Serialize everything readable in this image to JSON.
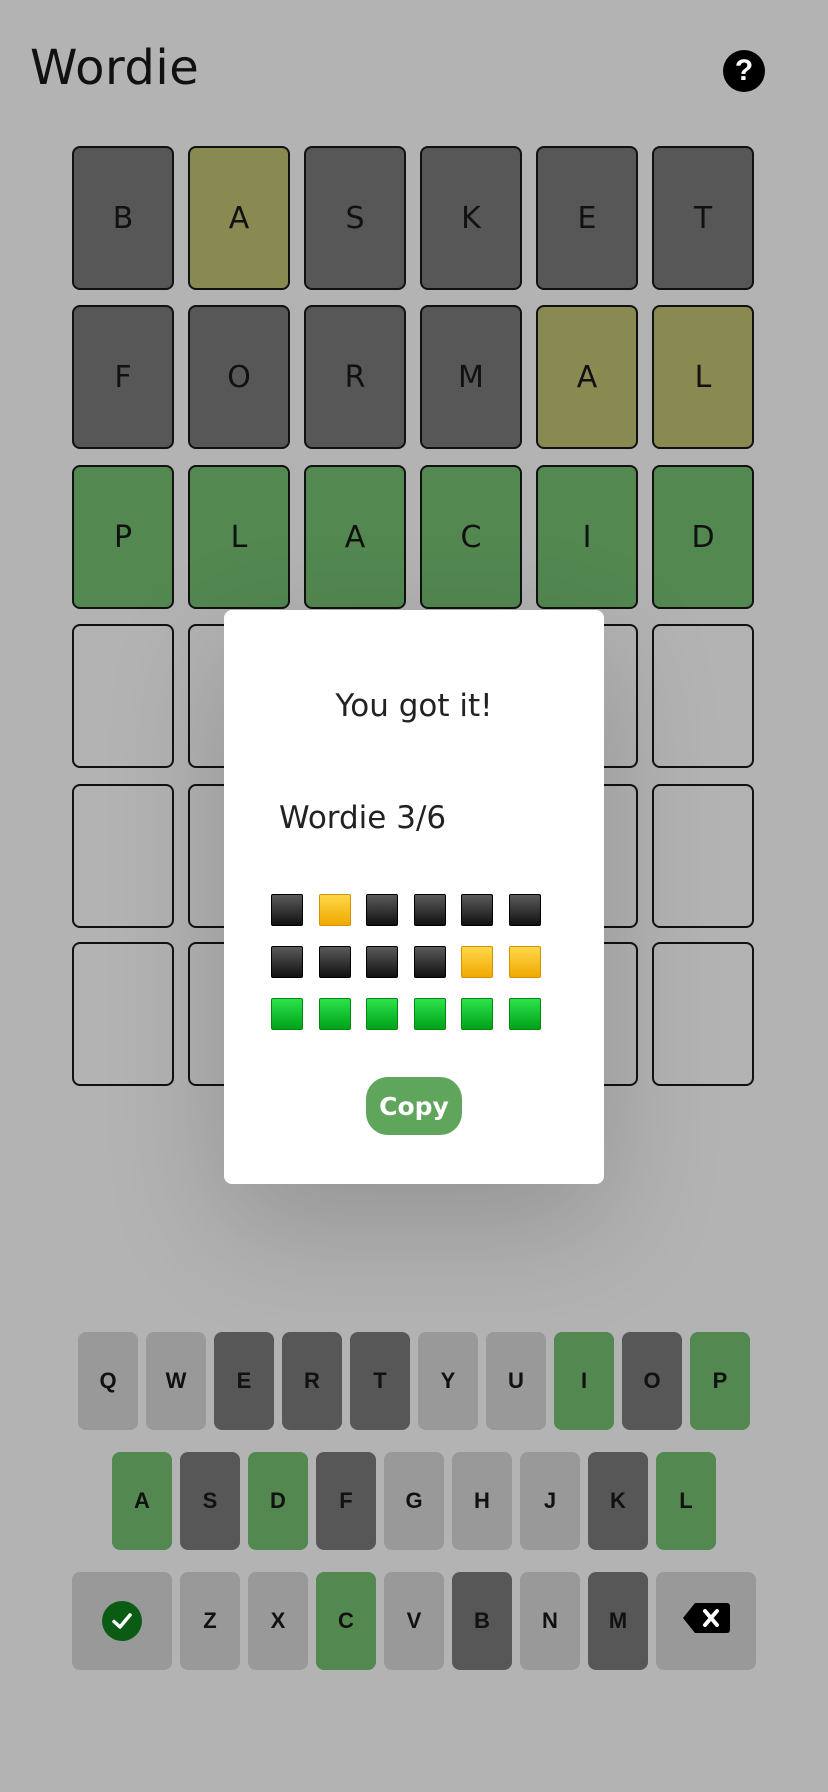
{
  "app": {
    "title": "Wordie",
    "help_icon": "question-icon",
    "help_label": "?"
  },
  "board": {
    "rows": [
      {
        "letters": [
          "B",
          "A",
          "S",
          "K",
          "E",
          "T"
        ],
        "states": [
          "gray",
          "yellow",
          "gray",
          "gray",
          "gray",
          "gray"
        ]
      },
      {
        "letters": [
          "F",
          "O",
          "R",
          "M",
          "A",
          "L"
        ],
        "states": [
          "gray",
          "gray",
          "gray",
          "gray",
          "yellow",
          "yellow"
        ]
      },
      {
        "letters": [
          "P",
          "L",
          "A",
          "C",
          "I",
          "D"
        ],
        "states": [
          "green",
          "green",
          "green",
          "green",
          "green",
          "green"
        ]
      },
      {
        "letters": [
          "",
          "",
          "",
          "",
          "",
          ""
        ],
        "states": [
          "empty",
          "empty",
          "empty",
          "empty",
          "empty",
          "empty"
        ]
      },
      {
        "letters": [
          "",
          "",
          "",
          "",
          "",
          ""
        ],
        "states": [
          "empty",
          "empty",
          "empty",
          "empty",
          "empty",
          "empty"
        ]
      },
      {
        "letters": [
          "",
          "",
          "",
          "",
          "",
          ""
        ],
        "states": [
          "empty",
          "empty",
          "empty",
          "empty",
          "empty",
          "empty"
        ]
      }
    ]
  },
  "modal": {
    "title": "You got it!",
    "share_title": "Wordie 3/6",
    "grid": [
      [
        "black",
        "yellow",
        "black",
        "black",
        "black",
        "black"
      ],
      [
        "black",
        "black",
        "black",
        "black",
        "yellow",
        "yellow"
      ],
      [
        "green",
        "green",
        "green",
        "green",
        "green",
        "green"
      ]
    ],
    "copy_label": "Copy"
  },
  "keyboard": {
    "rows": [
      [
        {
          "label": "Q",
          "state": "unused"
        },
        {
          "label": "W",
          "state": "unused"
        },
        {
          "label": "E",
          "state": "absent"
        },
        {
          "label": "R",
          "state": "absent"
        },
        {
          "label": "T",
          "state": "absent"
        },
        {
          "label": "Y",
          "state": "unused"
        },
        {
          "label": "U",
          "state": "unused"
        },
        {
          "label": "I",
          "state": "correct"
        },
        {
          "label": "O",
          "state": "absent"
        },
        {
          "label": "P",
          "state": "correct"
        }
      ],
      [
        {
          "label": "A",
          "state": "correct"
        },
        {
          "label": "S",
          "state": "absent"
        },
        {
          "label": "D",
          "state": "correct"
        },
        {
          "label": "F",
          "state": "absent"
        },
        {
          "label": "G",
          "state": "unused"
        },
        {
          "label": "H",
          "state": "unused"
        },
        {
          "label": "J",
          "state": "unused"
        },
        {
          "label": "K",
          "state": "absent"
        },
        {
          "label": "L",
          "state": "correct"
        }
      ],
      [
        {
          "label": "",
          "state": "special",
          "icon": "check-circle-icon"
        },
        {
          "label": "Z",
          "state": "unused"
        },
        {
          "label": "X",
          "state": "unused"
        },
        {
          "label": "C",
          "state": "correct"
        },
        {
          "label": "V",
          "state": "unused"
        },
        {
          "label": "B",
          "state": "absent"
        },
        {
          "label": "N",
          "state": "unused"
        },
        {
          "label": "M",
          "state": "absent"
        },
        {
          "label": "",
          "state": "special",
          "icon": "backspace-icon"
        }
      ]
    ]
  },
  "colors": {
    "background": "#b3b3b3",
    "gray": "#575757",
    "yellow": "#898952",
    "green": "#538851",
    "unused_key": "#999999",
    "copy_button": "#5fa65c"
  }
}
